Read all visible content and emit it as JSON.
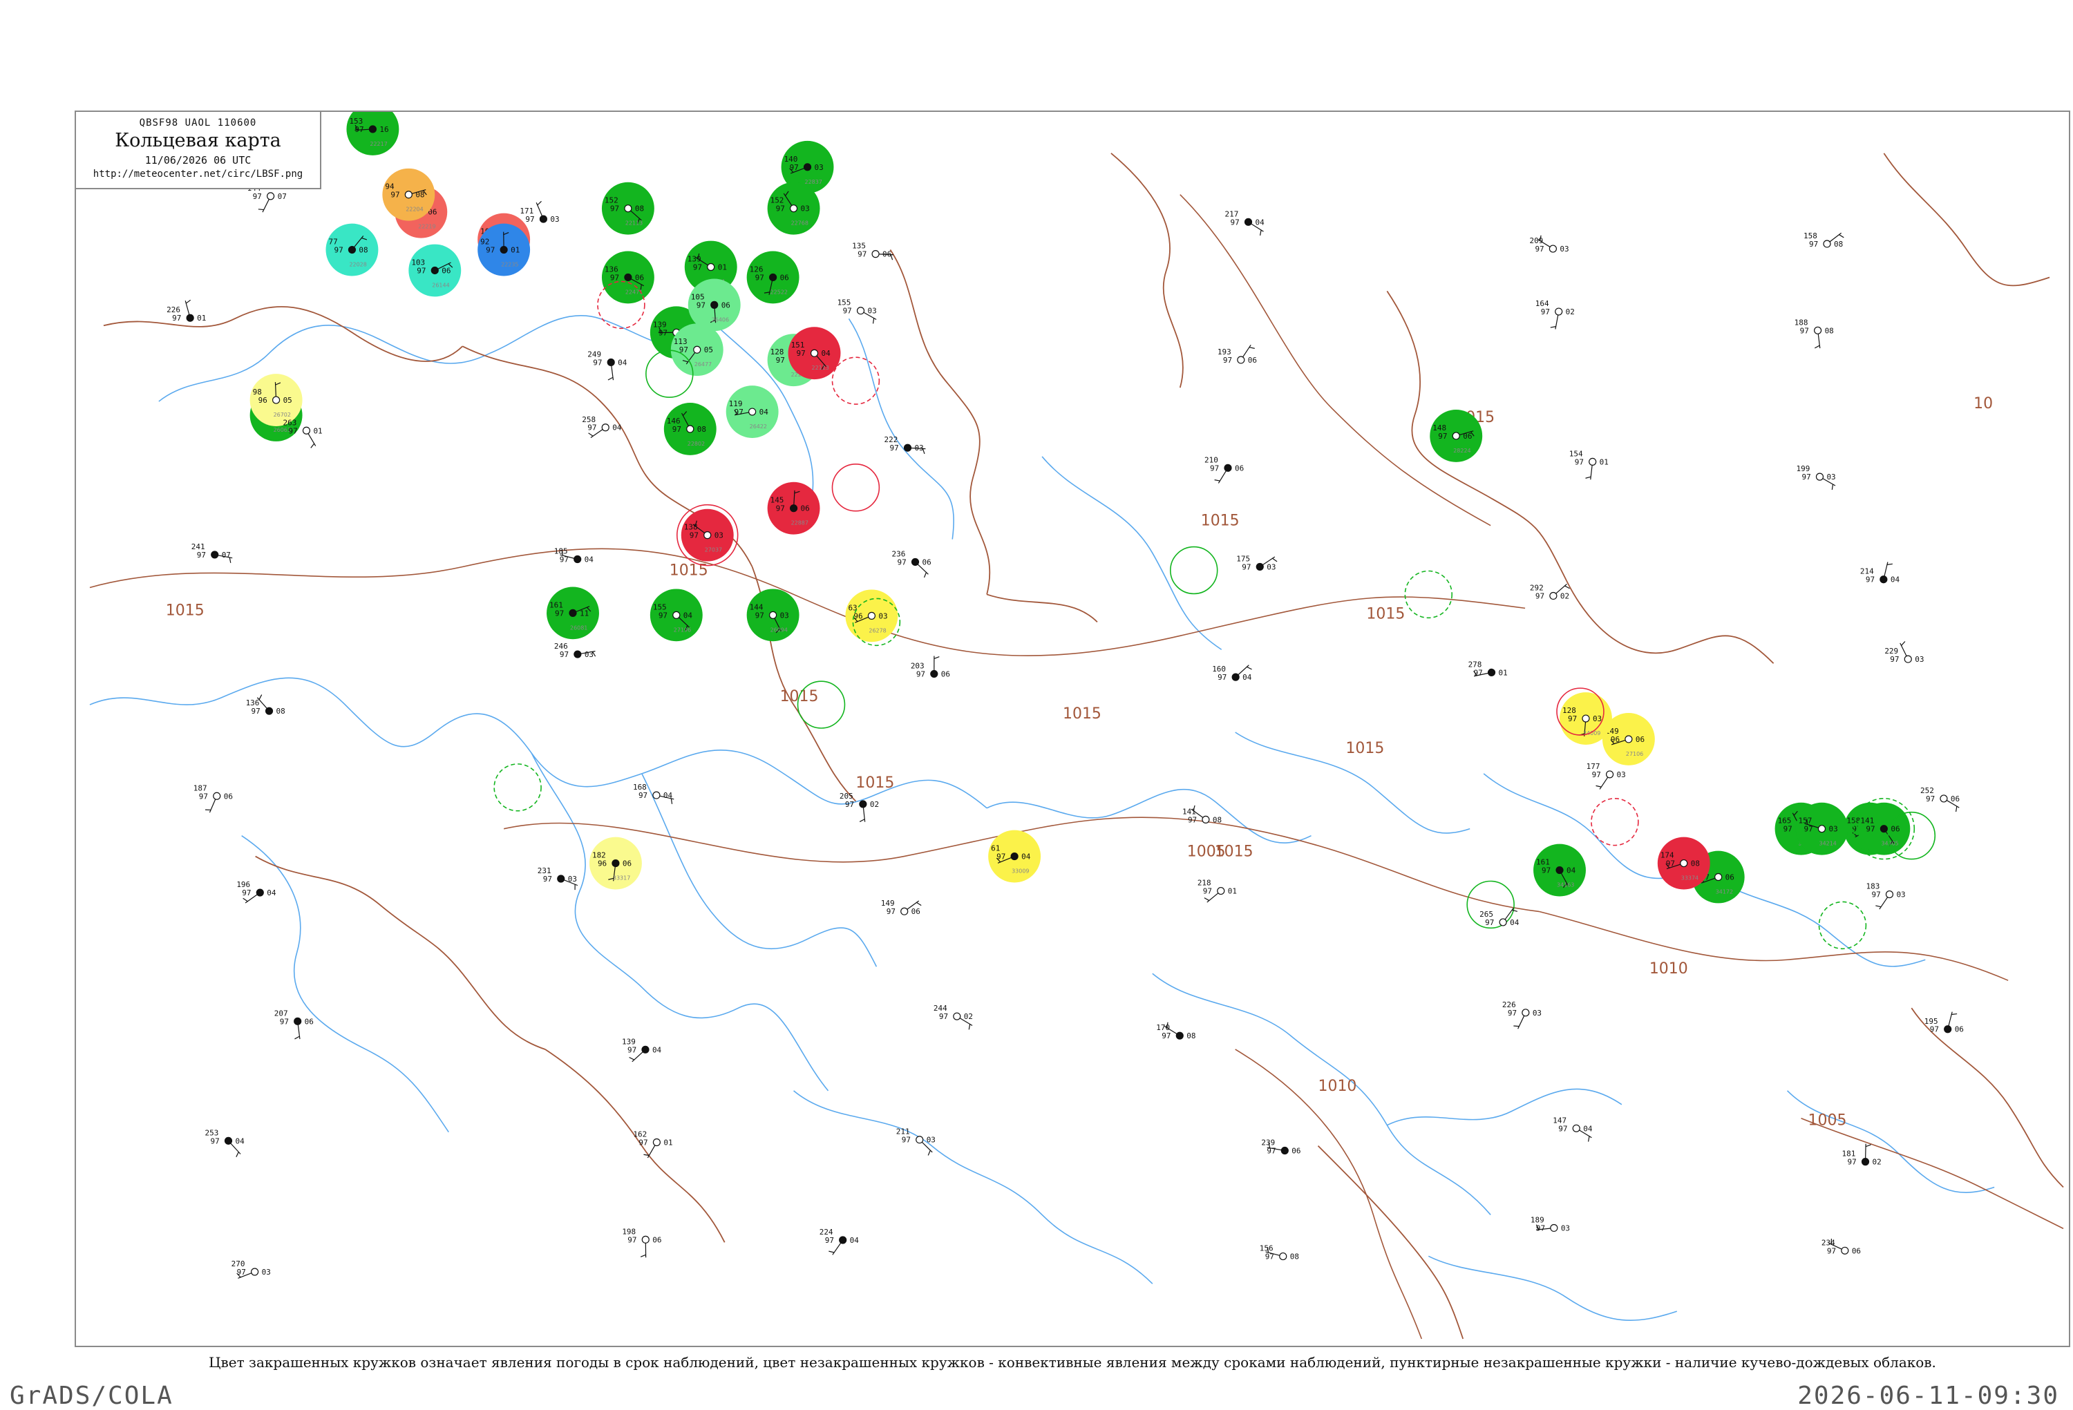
{
  "legend": {
    "code_line": "QBSF98  UAOL  110600",
    "title": "Кольцевая карта",
    "date": "11/06/2026 06 UTC",
    "url": "http://meteocenter.net/circ/LBSF.png"
  },
  "caption": "Цвет закрашенных кружков означает явления погоды в срок наблюдений, цвет незакрашенных кружков - конвективные явления между сроками наблюдений, пунктирные незакрашенные кружки - наличие кучево-дождевых облаков.",
  "footer": {
    "left": "GrADS/COLA",
    "right": "2026-06-11-09:30"
  },
  "colors": {
    "coast": "#5aa9ee",
    "border": "#a2573a",
    "isobar": "#a2573a",
    "green": "#13b51f",
    "light_green": "#6cea8f",
    "red": "#e5283f",
    "salmon": "#f2635d",
    "orange": "#f5b24a",
    "yellow": "#fbf24a",
    "pale_yellow": "#fafa8e",
    "cyan": "#39e6c5",
    "blue": "#2f86e8"
  },
  "isobar_labels": [
    "1015",
    "1015",
    "1015",
    "1015",
    "1015",
    "1015",
    "1015",
    "1015",
    "1015",
    "1015",
    "1010",
    "1010",
    "1005",
    "1005",
    "10"
  ],
  "stations": [
    {
      "fill": "green",
      "ring": "none",
      "t": "153",
      "p": "97",
      "d": "16",
      "i": "22217"
    },
    {
      "fill": "green",
      "ring": "none",
      "t": "152",
      "p": "97",
      "d": "08",
      "i": "22113"
    },
    {
      "fill": "green",
      "ring": "none",
      "t": "140",
      "p": "97",
      "d": "03",
      "i": "22837"
    },
    {
      "fill": "green",
      "ring": "none",
      "t": "136",
      "p": "97",
      "d": "06",
      "i": "22471"
    },
    {
      "fill": "green",
      "ring": "none",
      "t": "139",
      "p": "97",
      "d": "01",
      "i": "22641"
    },
    {
      "fill": "green",
      "ring": "none",
      "t": "126",
      "p": "97",
      "d": "06",
      "i": "22522"
    },
    {
      "fill": "green",
      "ring": "none",
      "t": "152",
      "p": "97",
      "d": "03",
      "i": "22768"
    },
    {
      "fill": "green",
      "ring": "none",
      "t": "139",
      "p": "97",
      "d": "06",
      "i": "22550"
    },
    {
      "fill": "green",
      "ring": "none",
      "t": "146",
      "p": "97",
      "d": "08",
      "i": "22802"
    },
    {
      "fill": "green",
      "ring": "none",
      "t": "143",
      "p": "97",
      "d": "07",
      "i": "26063"
    },
    {
      "fill": "green",
      "ring": "none",
      "t": "144",
      "p": "97",
      "d": "03",
      "i": "26094"
    },
    {
      "fill": "green",
      "ring": "none",
      "t": "161",
      "p": "97",
      "d": "11",
      "i": "26081"
    },
    {
      "fill": "green",
      "ring": "none",
      "t": "155",
      "p": "97",
      "d": "04",
      "i": "27196"
    },
    {
      "fill": "green",
      "ring": "none",
      "t": "148",
      "p": "97",
      "d": "06",
      "i": "28224"
    },
    {
      "fill": "green",
      "ring": "none",
      "t": "158",
      "p": "97",
      "d": "03",
      "i": "33317"
    },
    {
      "fill": "green",
      "ring": "none",
      "t": "165",
      "p": "97",
      "d": "06",
      "i": "33345"
    },
    {
      "fill": "green",
      "ring": "none",
      "t": "161",
      "p": "97",
      "d": "04",
      "i": "34163"
    },
    {
      "fill": "green",
      "ring": "none",
      "t": "149",
      "p": "97",
      "d": "06",
      "i": "34172"
    },
    {
      "fill": "green",
      "ring": "none",
      "t": "157",
      "p": "97",
      "d": "03",
      "i": "34214"
    },
    {
      "fill": "green",
      "ring": "dash",
      "t": "141",
      "p": "97",
      "d": "06",
      "i": "34305"
    },
    {
      "fill": "light_green",
      "ring": "none",
      "t": "113",
      "p": "97",
      "d": "05",
      "i": "26477"
    },
    {
      "fill": "light_green",
      "ring": "none",
      "t": "128",
      "p": "97",
      "d": "03",
      "i": "22262"
    },
    {
      "fill": "light_green",
      "ring": "none",
      "t": "105",
      "p": "97",
      "d": "06",
      "i": "26406"
    },
    {
      "fill": "light_green",
      "ring": "none",
      "t": "119",
      "p": "97",
      "d": "04",
      "i": "26422"
    },
    {
      "fill": "red",
      "ring": "solid",
      "t": "138",
      "p": "97",
      "d": "03",
      "i": "27037"
    },
    {
      "fill": "red",
      "ring": "none",
      "t": "145",
      "p": "97",
      "d": "06",
      "i": "22887"
    },
    {
      "fill": "red",
      "ring": "none",
      "t": "151",
      "p": "97",
      "d": "04",
      "i": "22113"
    },
    {
      "fill": "red",
      "ring": "none",
      "t": "174",
      "p": "97",
      "d": "08",
      "i": "33374"
    },
    {
      "fill": "salmon",
      "ring": "none",
      "t": "101",
      "p": "97",
      "d": "03",
      "i": "22235"
    },
    {
      "fill": "salmon",
      "ring": "none",
      "t": "96",
      "p": "97",
      "d": "06",
      "i": "22219"
    },
    {
      "fill": "orange",
      "ring": "none",
      "t": "94",
      "p": "97",
      "d": "08",
      "i": "22204"
    },
    {
      "fill": "yellow",
      "ring": "none",
      "t": "63",
      "p": "96",
      "d": "03",
      "i": "26278"
    },
    {
      "fill": "yellow",
      "ring": "none",
      "t": "61",
      "p": "97",
      "d": "04",
      "i": "33009"
    },
    {
      "fill": "yellow",
      "ring": "none",
      "t": "149",
      "p": "96",
      "d": "06",
      "i": "27106"
    },
    {
      "fill": "yellow",
      "ring": "none",
      "t": "128",
      "p": "97",
      "d": "03",
      "i": "34009"
    },
    {
      "fill": "pale_yellow",
      "ring": "none",
      "t": "98",
      "p": "96",
      "d": "05",
      "i": "26702"
    },
    {
      "fill": "pale_yellow",
      "ring": "none",
      "t": "182",
      "p": "96",
      "d": "06",
      "i": "33317"
    },
    {
      "fill": "cyan",
      "ring": "none",
      "t": "77",
      "p": "97",
      "d": "08",
      "i": "22028"
    },
    {
      "fill": "cyan",
      "ring": "none",
      "t": "103",
      "p": "97",
      "d": "06",
      "i": "26144"
    },
    {
      "fill": "blue",
      "ring": "none",
      "t": "92",
      "p": "97",
      "d": "01",
      "i": "22235"
    }
  ],
  "plain_stations": [
    {
      "t": "144",
      "p": "97",
      "d": "07"
    },
    {
      "t": "171",
      "p": "97",
      "d": "03"
    },
    {
      "t": "135",
      "p": "97",
      "d": "06"
    },
    {
      "t": "217",
      "p": "97",
      "d": "04"
    },
    {
      "t": "209",
      "p": "97",
      "d": "03"
    },
    {
      "t": "158",
      "p": "97",
      "d": "08"
    },
    {
      "t": "226",
      "p": "97",
      "d": "01"
    },
    {
      "t": "249",
      "p": "97",
      "d": "04"
    },
    {
      "t": "155",
      "p": "97",
      "d": "03"
    },
    {
      "t": "193",
      "p": "97",
      "d": "06"
    },
    {
      "t": "164",
      "p": "97",
      "d": "02"
    },
    {
      "t": "188",
      "p": "97",
      "d": "08"
    },
    {
      "t": "263",
      "p": "97",
      "d": "01"
    },
    {
      "t": "258",
      "p": "97",
      "d": "04"
    },
    {
      "t": "222",
      "p": "97",
      "d": "03"
    },
    {
      "t": "210",
      "p": "97",
      "d": "06"
    },
    {
      "t": "154",
      "p": "97",
      "d": "01"
    },
    {
      "t": "199",
      "p": "97",
      "d": "03"
    },
    {
      "t": "241",
      "p": "97",
      "d": "07"
    },
    {
      "t": "185",
      "p": "97",
      "d": "04"
    },
    {
      "t": "236",
      "p": "97",
      "d": "06"
    },
    {
      "t": "175",
      "p": "97",
      "d": "03"
    },
    {
      "t": "292",
      "p": "97",
      "d": "02"
    },
    {
      "t": "214",
      "p": "97",
      "d": "04"
    },
    {
      "t": "136",
      "p": "97",
      "d": "08"
    },
    {
      "t": "246",
      "p": "97",
      "d": "03"
    },
    {
      "t": "203",
      "p": "97",
      "d": "06"
    },
    {
      "t": "160",
      "p": "97",
      "d": "04"
    },
    {
      "t": "278",
      "p": "97",
      "d": "01"
    },
    {
      "t": "229",
      "p": "97",
      "d": "03"
    },
    {
      "t": "187",
      "p": "97",
      "d": "06"
    },
    {
      "t": "168",
      "p": "97",
      "d": "04"
    },
    {
      "t": "205",
      "p": "97",
      "d": "02"
    },
    {
      "t": "141",
      "p": "97",
      "d": "08"
    },
    {
      "t": "177",
      "p": "97",
      "d": "03"
    },
    {
      "t": "252",
      "p": "97",
      "d": "06"
    },
    {
      "t": "196",
      "p": "97",
      "d": "04"
    },
    {
      "t": "231",
      "p": "97",
      "d": "03"
    },
    {
      "t": "149",
      "p": "97",
      "d": "06"
    },
    {
      "t": "218",
      "p": "97",
      "d": "01"
    },
    {
      "t": "265",
      "p": "97",
      "d": "04"
    },
    {
      "t": "183",
      "p": "97",
      "d": "03"
    },
    {
      "t": "207",
      "p": "97",
      "d": "06"
    },
    {
      "t": "139",
      "p": "97",
      "d": "04"
    },
    {
      "t": "244",
      "p": "97",
      "d": "02"
    },
    {
      "t": "170",
      "p": "97",
      "d": "08"
    },
    {
      "t": "226",
      "p": "97",
      "d": "03"
    },
    {
      "t": "195",
      "p": "97",
      "d": "06"
    },
    {
      "t": "253",
      "p": "97",
      "d": "04"
    },
    {
      "t": "162",
      "p": "97",
      "d": "01"
    },
    {
      "t": "211",
      "p": "97",
      "d": "03"
    },
    {
      "t": "239",
      "p": "97",
      "d": "06"
    },
    {
      "t": "147",
      "p": "97",
      "d": "04"
    },
    {
      "t": "181",
      "p": "97",
      "d": "02"
    },
    {
      "t": "270",
      "p": "97",
      "d": "03"
    },
    {
      "t": "198",
      "p": "97",
      "d": "06"
    },
    {
      "t": "224",
      "p": "97",
      "d": "04"
    },
    {
      "t": "156",
      "p": "97",
      "d": "08"
    },
    {
      "t": "189",
      "p": "97",
      "d": "03"
    },
    {
      "t": "234",
      "p": "97",
      "d": "06"
    }
  ]
}
